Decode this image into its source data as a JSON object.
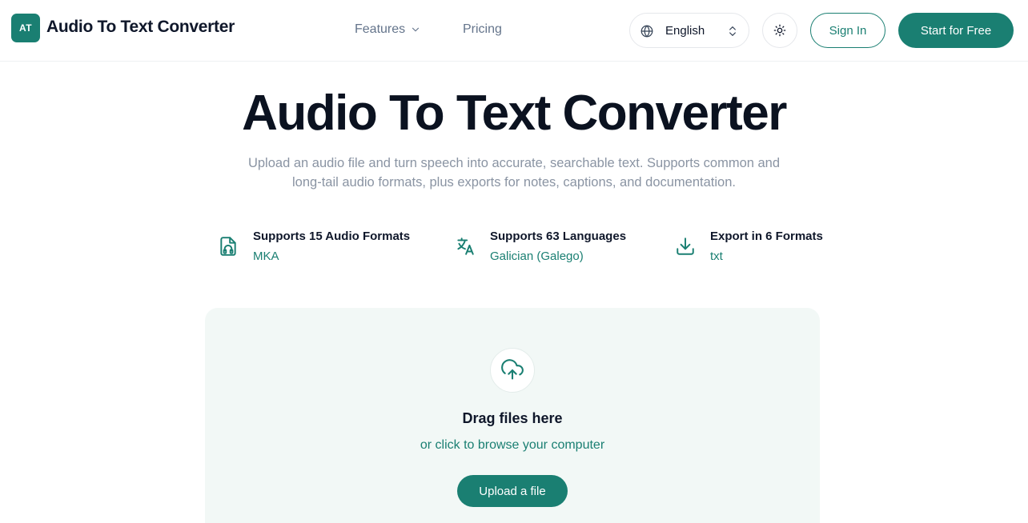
{
  "header": {
    "logo_text": "AT",
    "brand": "Audio To Text Converter",
    "nav": {
      "features_label": "Features",
      "pricing_label": "Pricing"
    },
    "language": "English",
    "signin_label": "Sign In",
    "start_label": "Start for Free"
  },
  "hero": {
    "title": "Audio To Text Converter",
    "subtitle": "Upload an audio file and turn speech into accurate, searchable text. Supports common and long-tail audio formats, plus exports for notes, captions, and documentation."
  },
  "features": [
    {
      "title": "Supports 15 Audio Formats",
      "detail": "MKA",
      "icon": "audio-file-icon"
    },
    {
      "title": "Supports 63 Languages",
      "detail": "Galician (Galego)",
      "icon": "translate-icon"
    },
    {
      "title": "Export in 6 Formats",
      "detail": "txt",
      "icon": "download-icon"
    }
  ],
  "upload": {
    "title": "Drag files here",
    "subtitle": "or click to browse your computer",
    "button_label": "Upload a file"
  },
  "colors": {
    "accent": "#1a7f72",
    "dropzone_bg": "#f2f8f6",
    "muted_text": "#8a94a3"
  }
}
